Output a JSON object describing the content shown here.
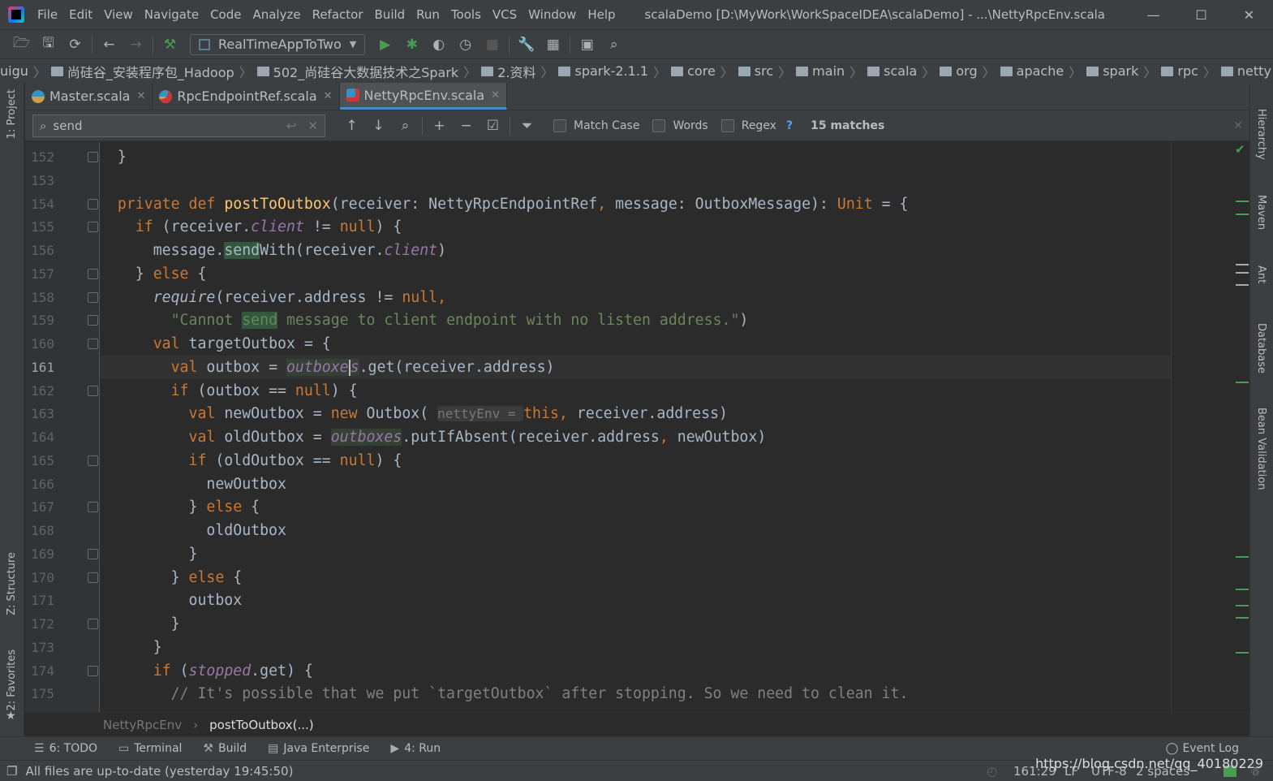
{
  "window": {
    "title": "scalaDemo [D:\\MyWork\\WorkSpaceIDEA\\scalaDemo] - ...\\NettyRpcEnv.scala",
    "minimize": "—",
    "maximize": "☐",
    "close": "✕"
  },
  "menu": [
    "File",
    "Edit",
    "View",
    "Navigate",
    "Code",
    "Analyze",
    "Refactor",
    "Build",
    "Run",
    "Tools",
    "VCS",
    "Window",
    "Help"
  ],
  "toolbar": {
    "run_config": "RealTimeAppToTwo"
  },
  "navbar": [
    "uigu",
    "尚硅谷_安装程序包_Hadoop",
    "502_尚硅谷大数据技术之Spark",
    "2.资料",
    "spark-2.1.1",
    "core",
    "src",
    "main",
    "scala",
    "org",
    "apache",
    "spark",
    "rpc",
    "netty",
    "NettyRpcEnv.scala"
  ],
  "tabs": [
    {
      "label": "Master.scala",
      "active": false
    },
    {
      "label": "RpcEndpointRef.scala",
      "active": false
    },
    {
      "label": "NettyRpcEnv.scala",
      "active": true
    }
  ],
  "search": {
    "value": "send",
    "match_case": "Match Case",
    "words": "Words",
    "regex": "Regex",
    "help": "?",
    "matches": "15 matches"
  },
  "left_tools": {
    "project": "1: Project",
    "structure": "Z: Structure",
    "favorites": "2: Favorites"
  },
  "right_tools": {
    "hierarchy": "Hierarchy",
    "maven": "Maven",
    "ant": "Ant",
    "database": "Database",
    "bean": "Bean Validation"
  },
  "colors": {
    "keyword": "#cc7832",
    "function": "#ffc66d",
    "string": "#6a8759",
    "field": "#9876aa",
    "comment": "#808080",
    "text": "#a9b7c6",
    "highlight_box": "#e03c3c"
  },
  "editor": {
    "current_line": 161,
    "lines": [
      {
        "n": "152",
        "t": [
          [
            "  }",
            "n"
          ]
        ]
      },
      {
        "n": "153",
        "t": []
      },
      {
        "n": "154",
        "t": [
          [
            "  ",
            "n"
          ],
          [
            "private def ",
            "k"
          ],
          [
            "postToOutbox",
            "f"
          ],
          [
            "(receiver: NettyRpcEndpointRef",
            "n"
          ],
          [
            ", ",
            "k"
          ],
          [
            "message: OutboxMessage): ",
            "n"
          ],
          [
            "Unit",
            "k"
          ],
          [
            " = {",
            "n"
          ]
        ]
      },
      {
        "n": "155",
        "t": [
          [
            "    ",
            "n"
          ],
          [
            "if ",
            "k"
          ],
          [
            "(receiver.",
            "n"
          ],
          [
            "client",
            "i"
          ],
          [
            " != ",
            "n"
          ],
          [
            "null",
            "k"
          ],
          [
            ") {",
            "n"
          ]
        ]
      },
      {
        "n": "156",
        "t": [
          [
            "      message.",
            "n"
          ],
          [
            "send",
            "h"
          ],
          [
            "With(receiver.",
            "n"
          ],
          [
            "client",
            "i"
          ],
          [
            ")",
            "n"
          ]
        ]
      },
      {
        "n": "157",
        "t": [
          [
            "    } ",
            "n"
          ],
          [
            "else ",
            "k"
          ],
          [
            "{",
            "n"
          ]
        ]
      },
      {
        "n": "158",
        "t": [
          [
            "      ",
            "n"
          ],
          [
            "require",
            "it"
          ],
          [
            "(receiver.address != ",
            "n"
          ],
          [
            "null",
            "k"
          ],
          [
            ",",
            "k"
          ]
        ]
      },
      {
        "n": "159",
        "t": [
          [
            "        ",
            "n"
          ],
          [
            "\"Cannot ",
            "s"
          ],
          [
            "send",
            "hs"
          ],
          [
            " message to client endpoint with no listen address.\"",
            "s"
          ],
          [
            ")",
            "n"
          ]
        ]
      },
      {
        "n": "160",
        "t": [
          [
            "      ",
            "n"
          ],
          [
            "val ",
            "k"
          ],
          [
            "targetOutbox = {",
            "n"
          ]
        ]
      },
      {
        "n": "161",
        "t": [
          [
            "        ",
            "n"
          ],
          [
            "val ",
            "k"
          ],
          [
            "outbox = ",
            "n"
          ],
          [
            "outboxe",
            "i ihl"
          ],
          [
            "|",
            "caret"
          ],
          [
            "s",
            "i ihl"
          ],
          [
            ".get(receiver.address)",
            "n"
          ]
        ]
      },
      {
        "n": "162",
        "t": [
          [
            "        ",
            "n"
          ],
          [
            "if ",
            "k"
          ],
          [
            "(outbox == ",
            "n"
          ],
          [
            "null",
            "k"
          ],
          [
            ") {",
            "n"
          ]
        ]
      },
      {
        "n": "163",
        "t": [
          [
            "          ",
            "n"
          ],
          [
            "val ",
            "k"
          ],
          [
            "newOutbox = ",
            "n"
          ],
          [
            "new ",
            "k"
          ],
          [
            "Outbox( ",
            "n"
          ],
          [
            "nettyEnv = ",
            "p"
          ],
          [
            "this",
            "k"
          ],
          [
            ", ",
            "k"
          ],
          [
            "receiver.address)",
            "n"
          ]
        ]
      },
      {
        "n": "164",
        "t": [
          [
            "          ",
            "n"
          ],
          [
            "val ",
            "k"
          ],
          [
            "oldOutbox = ",
            "n"
          ],
          [
            "outboxes",
            "i ihl"
          ],
          [
            ".putIfAbsent(receiver.address",
            ""
          ],
          [
            ", ",
            "k"
          ],
          [
            "newOutbox)",
            "n"
          ]
        ]
      },
      {
        "n": "165",
        "t": [
          [
            "          ",
            "n"
          ],
          [
            "if ",
            "k"
          ],
          [
            "(oldOutbox == ",
            "n"
          ],
          [
            "null",
            "k"
          ],
          [
            ") {",
            "n"
          ]
        ]
      },
      {
        "n": "166",
        "t": [
          [
            "            newOutbox",
            "n"
          ]
        ]
      },
      {
        "n": "167",
        "t": [
          [
            "          } ",
            "n"
          ],
          [
            "else ",
            "k"
          ],
          [
            "{",
            "n"
          ]
        ]
      },
      {
        "n": "168",
        "t": [
          [
            "            oldOutbox",
            "n"
          ]
        ]
      },
      {
        "n": "169",
        "t": [
          [
            "          }",
            "n"
          ]
        ]
      },
      {
        "n": "170",
        "t": [
          [
            "        } ",
            "n"
          ],
          [
            "else ",
            "k"
          ],
          [
            "{",
            "n"
          ]
        ]
      },
      {
        "n": "171",
        "t": [
          [
            "          outbox",
            "n"
          ]
        ]
      },
      {
        "n": "172",
        "t": [
          [
            "        }",
            "n"
          ]
        ]
      },
      {
        "n": "173",
        "t": [
          [
            "      }",
            "n"
          ]
        ]
      },
      {
        "n": "174",
        "t": [
          [
            "      ",
            "n"
          ],
          [
            "if ",
            "k"
          ],
          [
            "(",
            "n"
          ],
          [
            "stopped",
            "i"
          ],
          [
            ".get) {",
            "n"
          ]
        ]
      },
      {
        "n": "175",
        "t": [
          [
            "        // It's possible that we put `targetOutbox` after stopping. So we need to clean it.",
            "c"
          ]
        ]
      }
    ]
  },
  "breadcrumb": {
    "class": "NettyRpcEnv",
    "method": "postToOutbox(...)"
  },
  "tool_windows": [
    {
      "icon": "list-icon",
      "label": "6: TODO"
    },
    {
      "icon": "terminal-icon",
      "label": "Terminal"
    },
    {
      "icon": "hammer-icon",
      "label": "Build"
    },
    {
      "icon": "java-enterprise-icon",
      "label": "Java Enterprise"
    },
    {
      "icon": "run-icon",
      "label": "4: Run"
    }
  ],
  "event_log": "Event Log",
  "status": {
    "message": "All files are up-to-date (yesterday 19:45:50)",
    "position": "161:29",
    "line_sep": "LF",
    "encoding": "UTF-8",
    "indent": "2 spaces",
    "watermark": "https://blog.csdn.net/qq_40180229"
  }
}
